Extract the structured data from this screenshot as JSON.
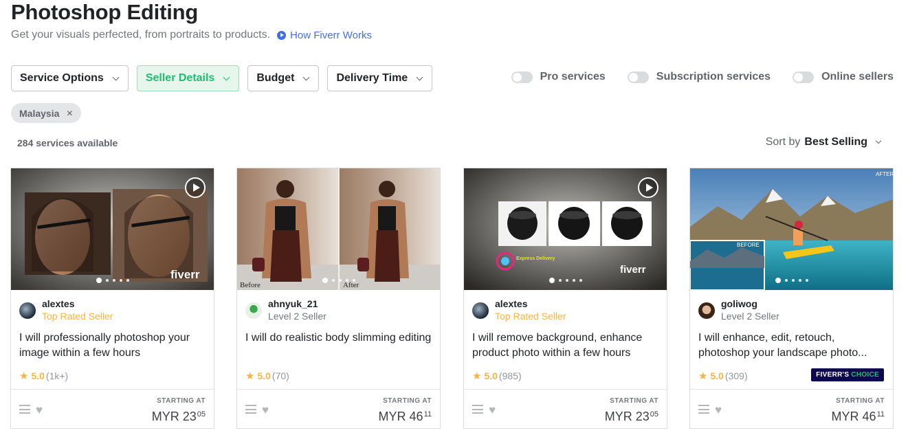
{
  "header": {
    "title": "Photoshop Editing",
    "subtitle": "Get your visuals perfected, from portraits to products.",
    "how_link": "How Fiverr Works"
  },
  "filters": [
    {
      "label": "Service Options",
      "active": false
    },
    {
      "label": "Seller Details",
      "active": true
    },
    {
      "label": "Budget",
      "active": false
    },
    {
      "label": "Delivery Time",
      "active": false
    }
  ],
  "toggles": [
    {
      "label": "Pro services"
    },
    {
      "label": "Subscription services"
    },
    {
      "label": "Online sellers"
    }
  ],
  "active_chip": {
    "label": "Malaysia"
  },
  "results": {
    "count": "284 services available",
    "sort_label": "Sort by",
    "sort_value": "Best Selling"
  },
  "colors": {
    "accent_green": "#1dbf73",
    "top_rated": "#ffb33e",
    "link_blue": "#446ee7",
    "choice_badge": "#0d084d"
  },
  "cards": [
    {
      "seller": "alextes",
      "level": "Top Rated Seller",
      "title": "I will professionally photoshop your image within a few hours",
      "rating": "5.0",
      "reviews": "(1k+)",
      "starting_label": "STARTING AT",
      "price_main": "MYR 23",
      "price_cents": "05",
      "has_video": true,
      "image_text": "fiverr"
    },
    {
      "seller": "ahnyuk_21",
      "level": "Level 2 Seller",
      "title": "I will do realistic body slimming editing",
      "rating": "5.0",
      "reviews": "(70)",
      "starting_label": "STARTING AT",
      "price_main": "MYR 46",
      "price_cents": "11",
      "has_video": false,
      "image_before": "Before",
      "image_after": "After"
    },
    {
      "seller": "alextes",
      "level": "Top Rated Seller",
      "title": "I will remove background, enhance product photo within a few hours",
      "rating": "5.0",
      "reviews": "(985)",
      "starting_label": "STARTING AT",
      "price_main": "MYR 23",
      "price_cents": "05",
      "has_video": true,
      "image_text": "fiverr",
      "image_badge": "Express Delivery"
    },
    {
      "seller": "goliwog",
      "level": "Level 2 Seller",
      "title": "I will enhance, edit, retouch, photoshop your landscape photo...",
      "rating": "5.0",
      "reviews": "(309)",
      "starting_label": "STARTING AT",
      "price_main": "MYR 46",
      "price_cents": "11",
      "has_video": false,
      "badge_pre": "FIVERR'S",
      "badge_post": "CHOICE",
      "image_before": "BEFORE",
      "image_after": "AFTER"
    }
  ]
}
